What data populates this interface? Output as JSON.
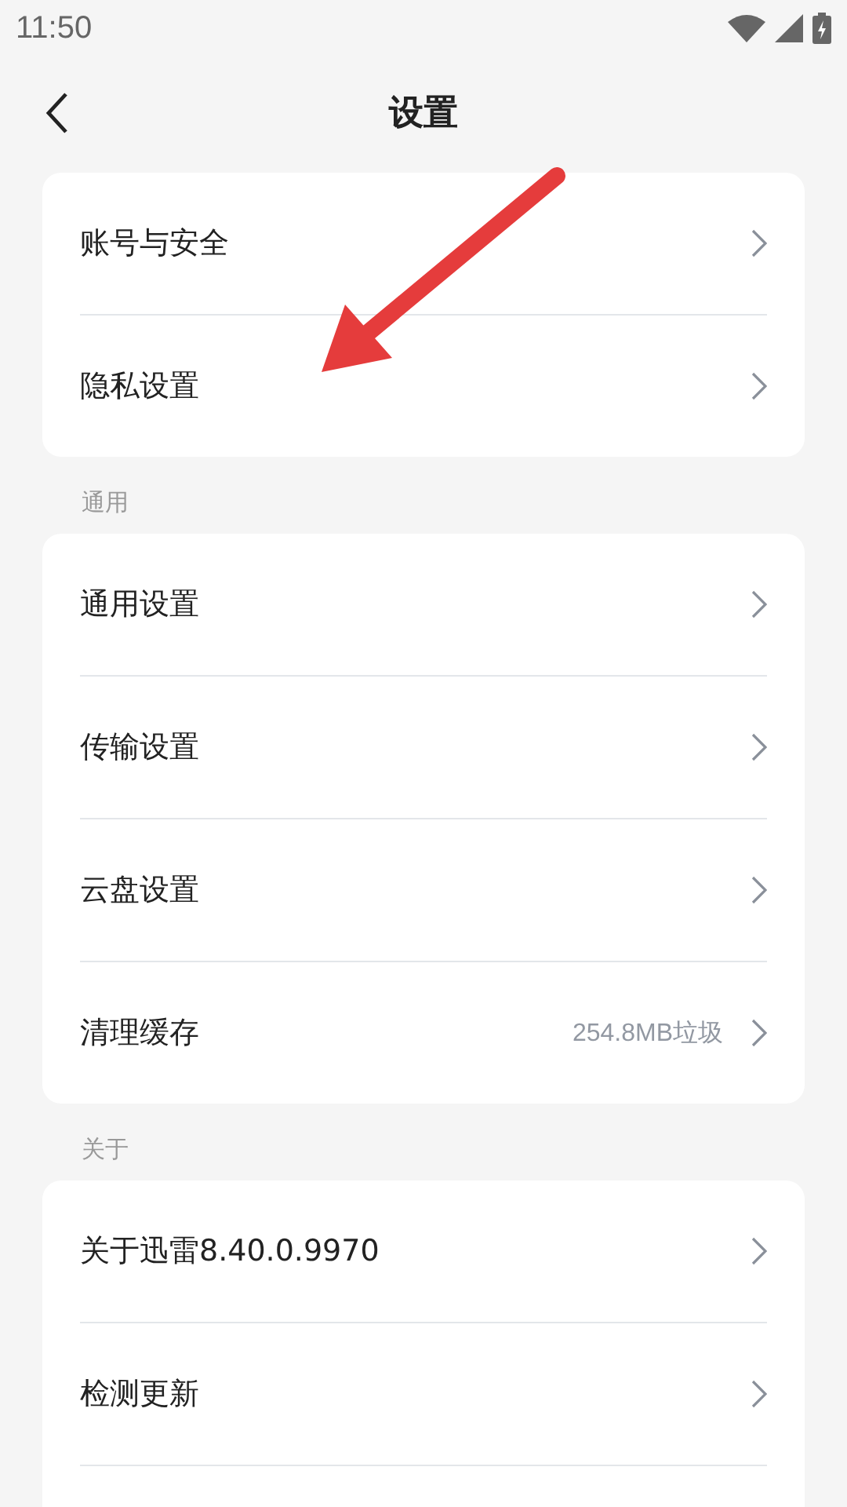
{
  "status_bar": {
    "time": "11:50"
  },
  "header": {
    "title": "设置"
  },
  "sections": [
    {
      "items": [
        {
          "label": "账号与安全"
        },
        {
          "label": "隐私设置"
        }
      ]
    },
    {
      "title": "通用",
      "items": [
        {
          "label": "通用设置"
        },
        {
          "label": "传输设置"
        },
        {
          "label": "云盘设置"
        },
        {
          "label": "清理缓存",
          "value": "254.8MB垃圾"
        }
      ]
    },
    {
      "title": "关于",
      "items": [
        {
          "label": "关于迅雷8.40.0.9970"
        },
        {
          "label": "检测更新"
        }
      ],
      "continues": true
    }
  ]
}
